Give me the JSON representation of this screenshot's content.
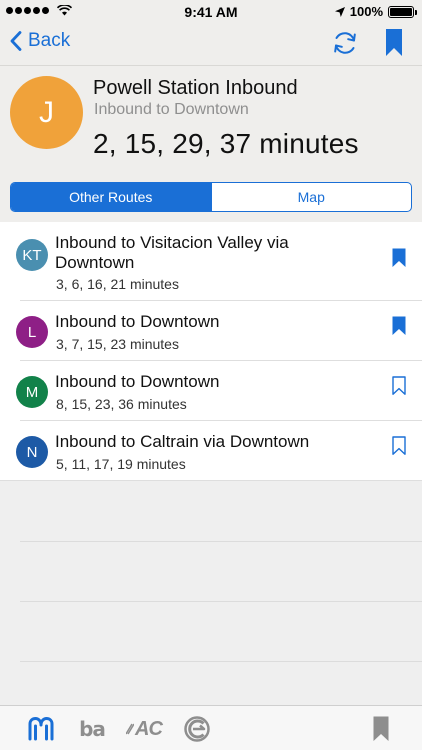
{
  "status_bar": {
    "time": "9:41 AM",
    "battery": "100%"
  },
  "nav": {
    "back_label": "Back"
  },
  "stop": {
    "avatar_letter": "J",
    "avatar_color": "#f0a23a",
    "name": "Powell Station Inbound",
    "direction": "Inbound to Downtown",
    "times": "2, 15, 29, 37 minutes"
  },
  "segment": {
    "options": [
      "Other Routes",
      "Map"
    ],
    "selected": "Other Routes"
  },
  "routes": [
    {
      "badge": "KT",
      "color": "#4a8fb0",
      "title": "Inbound to Visitacion Valley via Downtown",
      "times": "3, 6, 16, 21 minutes",
      "bookmarked": true
    },
    {
      "badge": "L",
      "color": "#8e1f86",
      "title": "Inbound to Downtown",
      "times": "3, 7, 15, 23 minutes",
      "bookmarked": true
    },
    {
      "badge": "M",
      "color": "#12824a",
      "title": "Inbound to Downtown",
      "times": "8, 15, 23, 36 minutes",
      "bookmarked": false
    },
    {
      "badge": "N",
      "color": "#1d5aa6",
      "title": "Inbound to Caltrain via Downtown",
      "times": "5, 11, 17, 19 minutes",
      "bookmarked": false
    }
  ],
  "tabs": {
    "bart_label": "ba",
    "ac_label": "AC"
  },
  "colors": {
    "accent": "#1a6fd6",
    "inactive_icon": "#8e8e8e"
  }
}
